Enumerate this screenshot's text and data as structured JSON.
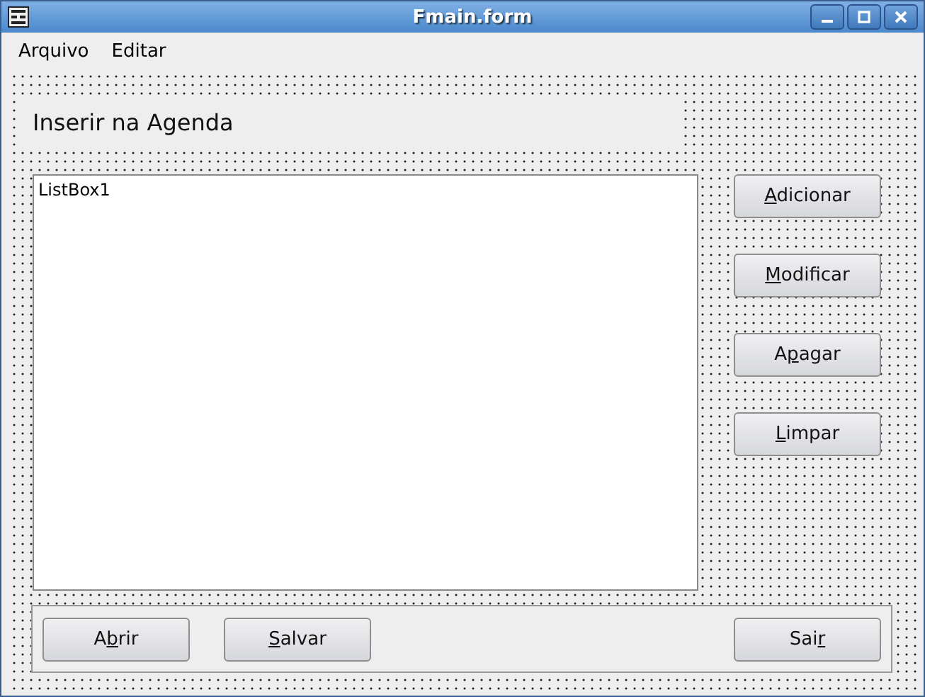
{
  "window": {
    "title": "Fmain.form"
  },
  "menu": [
    "Arquivo",
    "Editar"
  ],
  "heading": "Inserir na Agenda",
  "listbox": {
    "items": [
      "ListBox1"
    ]
  },
  "side_buttons": [
    {
      "label": [
        {
          "text": "A",
          "underline": true
        },
        {
          "text": "dicionar",
          "underline": false
        }
      ]
    },
    {
      "label": [
        {
          "text": "M",
          "underline": true
        },
        {
          "text": "odificar",
          "underline": false
        }
      ]
    },
    {
      "label": [
        {
          "text": "A",
          "underline": false
        },
        {
          "text": "p",
          "underline": true
        },
        {
          "text": "agar",
          "underline": false
        }
      ]
    },
    {
      "label": [
        {
          "text": "L",
          "underline": true
        },
        {
          "text": "impar",
          "underline": false
        }
      ]
    }
  ],
  "bottom_left_buttons": [
    {
      "label": [
        {
          "text": "A",
          "underline": false
        },
        {
          "text": "b",
          "underline": true
        },
        {
          "text": "rir",
          "underline": false
        }
      ]
    },
    {
      "label": [
        {
          "text": "S",
          "underline": true
        },
        {
          "text": "alvar",
          "underline": false
        }
      ]
    }
  ],
  "bottom_right_buttons": [
    {
      "label": [
        {
          "text": "Sai",
          "underline": false
        },
        {
          "text": "r",
          "underline": true
        }
      ]
    }
  ]
}
